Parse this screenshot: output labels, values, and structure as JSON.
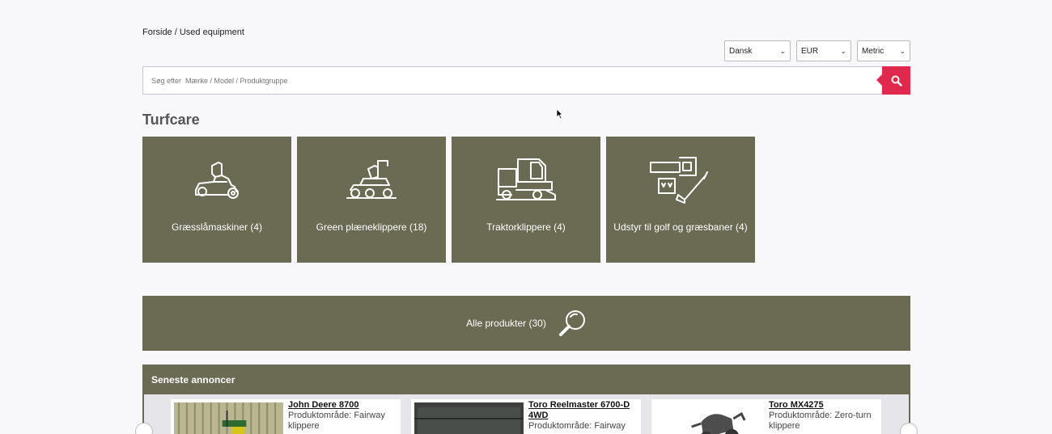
{
  "breadcrumb": {
    "home": "Forside",
    "separator": " / ",
    "current": "Used equipment"
  },
  "selectors": {
    "language": "Dansk",
    "currency": "EUR",
    "units": "Metric"
  },
  "search": {
    "placeholder": "Søg efter  Mærke / Model / Produktgruppe"
  },
  "section": {
    "title": "Turfcare"
  },
  "categories": [
    {
      "label": "Græsslåmaskiner (4)",
      "icon": "riding-mower-icon"
    },
    {
      "label": "Green plæneklippere (18)",
      "icon": "greens-mower-icon"
    },
    {
      "label": "Traktorklippere (4)",
      "icon": "tractor-mower-icon"
    },
    {
      "label": "Udstyr til golf og græsbaner (4)",
      "icon": "golf-equipment-icon"
    }
  ],
  "all_products": {
    "label": "Alle produkter (30)"
  },
  "latest": {
    "header": "Seneste annoncer",
    "cards": [
      {
        "title": "John Deere 8700",
        "area": "Produktområde: Fairway klippere"
      },
      {
        "title": "Toro Reelmaster 6700-D 4WD",
        "area": "Produktområde: Fairway"
      },
      {
        "title": "Toro MX4275",
        "area": "Produktområde: Zero-turn klippere"
      }
    ]
  },
  "colors": {
    "tile": "#6b6a53",
    "accent": "#e0294c",
    "background": "#f8f8fb"
  }
}
